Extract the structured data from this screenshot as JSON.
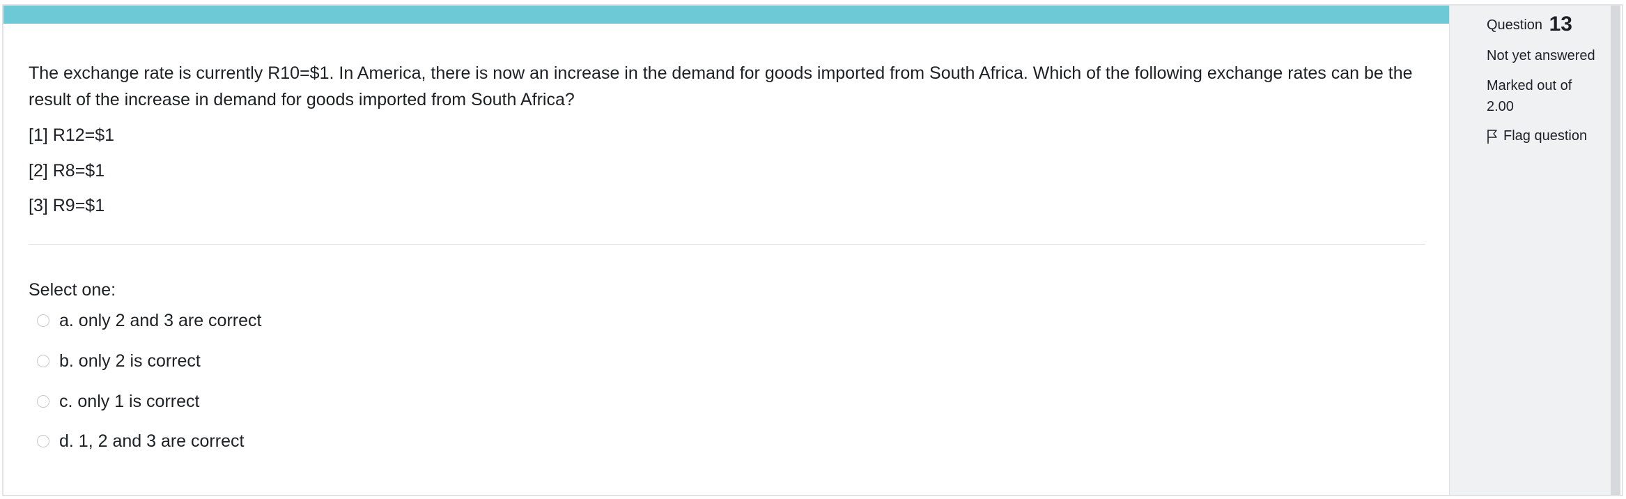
{
  "question": {
    "text": "The exchange rate is currently R10=$1. In America, there is now an increase in the demand for goods imported from South Africa. Which of the following exchange rates can be the result of the increase in demand for goods imported from South Africa?",
    "statements": [
      "[1] R12=$1",
      "[2] R8=$1",
      "[3] R9=$1"
    ],
    "select_label": "Select one:",
    "answers": [
      "a. only 2 and 3 are correct",
      "b. only 2 is correct",
      "c. only 1 is correct",
      "d. 1, 2 and 3 are correct"
    ]
  },
  "info": {
    "question_label": "Question",
    "question_number": "13",
    "status": "Not yet answered",
    "marked_out_of_label": "Marked out of",
    "marked_out_of_value": "2.00",
    "flag_label": "Flag question",
    "flag_icon": "flag-outline-icon"
  },
  "colors": {
    "accent_bar": "#6cc9d5",
    "sidebar_bg": "#f0f1f3",
    "text": "#1d2125"
  }
}
